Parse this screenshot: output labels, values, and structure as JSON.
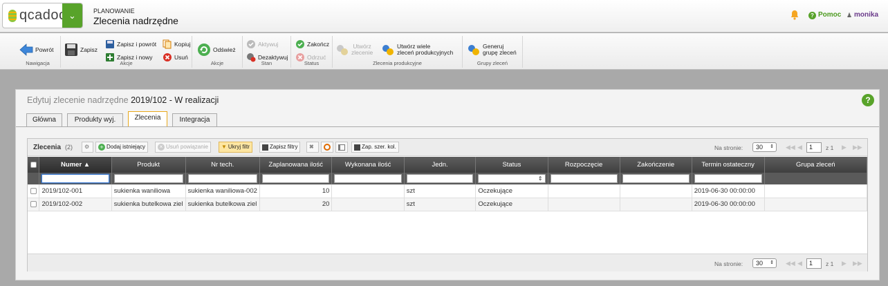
{
  "header": {
    "logo_text": "qcadoo",
    "section": "PLANOWANIE",
    "title": "Zlecenia nadrzędne",
    "help_label": "Pomoc",
    "user_name": "monika"
  },
  "ribbon": {
    "navigation": {
      "label": "Nawigacja",
      "back": "Powrót"
    },
    "actions": {
      "label": "Akcje",
      "save": "Zapisz",
      "save_back": "Zapisz i powrót",
      "save_new": "Zapisz i nowy",
      "copy": "Kopiuj",
      "delete": "Usuń"
    },
    "actions2": {
      "label": "Akcje",
      "refresh": "Odśwież"
    },
    "state": {
      "label": "Stan",
      "activate": "Aktywuj",
      "deactivate": "Dezaktywuj"
    },
    "status": {
      "label": "Status",
      "finish": "Zakończ",
      "reject": "Odrzuć"
    },
    "production_orders": {
      "label": "Zlecenia produkcyjne",
      "create_line1": "Utwórz",
      "create_line2": "zlecenie",
      "create_many_line1": "Utwórz wiele",
      "create_many_line2": "zleceń produkcyjnych"
    },
    "order_groups": {
      "label": "Grupy zleceń",
      "generate_line1": "Generuj",
      "generate_line2": "grupę zleceń"
    }
  },
  "form": {
    "title_prefix": "Edytuj zlecenie nadrzędne",
    "title_value": "2019/102 - W realizacji",
    "tabs": [
      "Główna",
      "Produkty wyj.",
      "Zlecenia",
      "Integracja"
    ],
    "active_tab": 2
  },
  "grid": {
    "title": "Zlecenia",
    "count": "(2)",
    "toolbar": {
      "add_existing": "Dodaj istniejący",
      "remove_link": "Usuń powiązanie",
      "hide_filter": "Ukryj filtr",
      "save_filters": "Zapisz filtry",
      "save_col_widths": "Zap. szer. kol."
    },
    "pager": {
      "per_page_label": "Na stronie:",
      "per_page": "30",
      "page": "1",
      "of_label": "z 1"
    },
    "columns": [
      "Numer",
      "Produkt",
      "Nr tech.",
      "Zaplanowana ilość",
      "Wykonana ilość",
      "Jedn.",
      "Status",
      "Rozpoczęcie",
      "Zakończenie",
      "Termin ostateczny",
      "Grupa zleceń"
    ],
    "sort_indicator": "▲",
    "rows": [
      {
        "number": "2019/102-001",
        "product": "sukienka waniliowa",
        "tech": "sukienka waniliowa-002",
        "planned": "10",
        "done": "",
        "unit": "szt",
        "status": "Oczekujące",
        "start": "",
        "end": "",
        "deadline": "2019-06-30 00:00:00",
        "group": ""
      },
      {
        "number": "2019/102-002",
        "product": "sukienka butelkowa ziel",
        "tech": "sukienka butelkowa ziel",
        "planned": "20",
        "done": "",
        "unit": "szt",
        "status": "Oczekujące",
        "start": "",
        "end": "",
        "deadline": "2019-06-30 00:00:00",
        "group": ""
      }
    ]
  },
  "colors": {
    "brand_green": "#58a32a",
    "link_blue": "#1a5da8",
    "tab_active_border": "#e8a81a",
    "header_dark": "#4a4a4a"
  }
}
